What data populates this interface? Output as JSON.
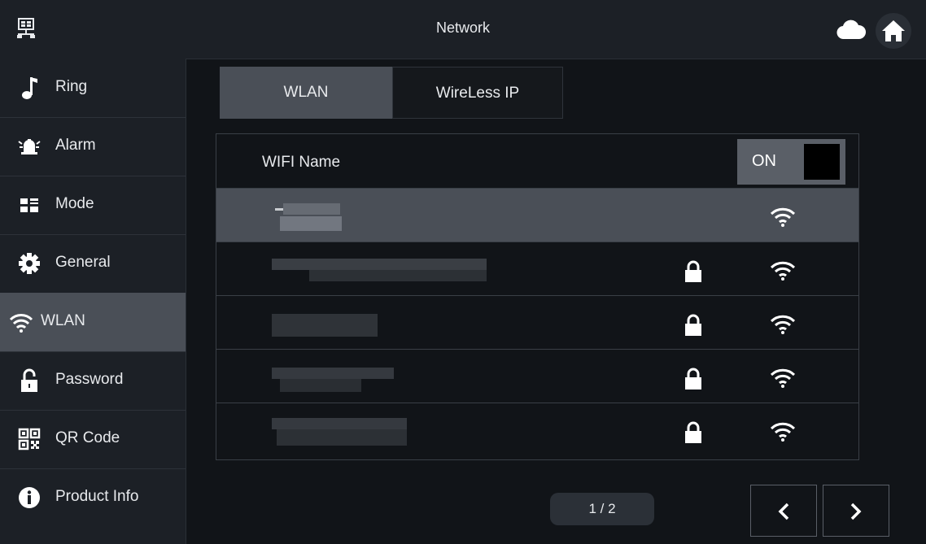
{
  "header": {
    "title": "Network"
  },
  "sidebar": {
    "items": [
      {
        "label": "Ring",
        "icon": "music-note-icon"
      },
      {
        "label": "Alarm",
        "icon": "alarm-icon"
      },
      {
        "label": "Mode",
        "icon": "mode-icon"
      },
      {
        "label": "General",
        "icon": "gear-icon"
      },
      {
        "label": "WLAN",
        "icon": "wifi-icon",
        "active": true
      },
      {
        "label": "Password",
        "icon": "lock-icon"
      },
      {
        "label": "QR Code",
        "icon": "qr-code-icon"
      },
      {
        "label": "Product Info",
        "icon": "info-icon"
      }
    ]
  },
  "tabs": [
    {
      "label": "WLAN",
      "active": true
    },
    {
      "label": "WireLess IP",
      "active": false
    }
  ],
  "wifi": {
    "header_label": "WIFI Name",
    "toggle_label": "ON",
    "networks": [
      {
        "ssid": "",
        "secured": false,
        "selected": true
      },
      {
        "ssid": "",
        "secured": true,
        "selected": false
      },
      {
        "ssid": "",
        "secured": true,
        "selected": false
      },
      {
        "ssid": "",
        "secured": true,
        "selected": false
      },
      {
        "ssid": "",
        "secured": true,
        "selected": false
      }
    ]
  },
  "pagination": {
    "text": "1 / 2"
  },
  "colors": {
    "background": "#111418",
    "panel": "#1c2026",
    "active": "#4a4f57",
    "toggle": "#5a5f67"
  }
}
